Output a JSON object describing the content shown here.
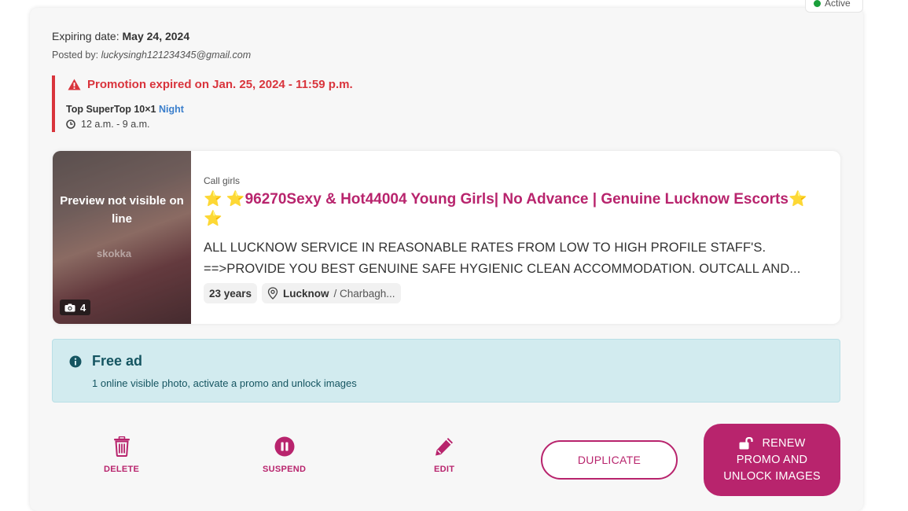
{
  "status": {
    "label": "Active",
    "color": "#1a9f3a"
  },
  "expiring": {
    "label": "Expiring date:",
    "date": "May 24, 2024"
  },
  "posted": {
    "label": "Posted by:",
    "email": "luckysingh121234345@gmail.com"
  },
  "promotion": {
    "expired_text": "Promotion expired on Jan. 25, 2024 - 11:59 p.m.",
    "plan": "Top SuperTop 10×1",
    "plan_period": "Night",
    "time_range": "12 a.m. - 9 a.m."
  },
  "listing": {
    "preview_text": "Preview not visible on line",
    "watermark": "skokka",
    "photo_count": "4",
    "category": "Call girls",
    "title": "⭐ ⭐96270Sexy & Hot44004 Young Girls| No Advance | Genuine Lucknow Escorts⭐ ⭐",
    "description_line1": "ALL LUCKNOW SERVICE IN REASONABLE RATES FROM LOW TO HIGH PROFILE STAFF'S.",
    "description_line2": "==>PROVIDE YOU BEST GENUINE SAFE HYGIENIC CLEAN ACCOMMODATION. OUTCALL AND...",
    "age": "23 years",
    "city": "Lucknow",
    "area": "/ Charbagh..."
  },
  "free_ad": {
    "title": "Free ad",
    "subtitle": "1 online visible photo, activate a promo and unlock images"
  },
  "actions": {
    "delete": "DELETE",
    "suspend": "SUSPEND",
    "edit": "EDIT",
    "duplicate": "DUPLICATE",
    "renew_line1": "RENEW",
    "renew_line2": "PROMO AND",
    "renew_line3": "UNLOCK IMAGES"
  },
  "colors": {
    "accent": "#b8246d",
    "danger": "#d9343c",
    "info_bg": "#d2ebef",
    "info_text": "#155561",
    "link": "#3b7fcc"
  }
}
